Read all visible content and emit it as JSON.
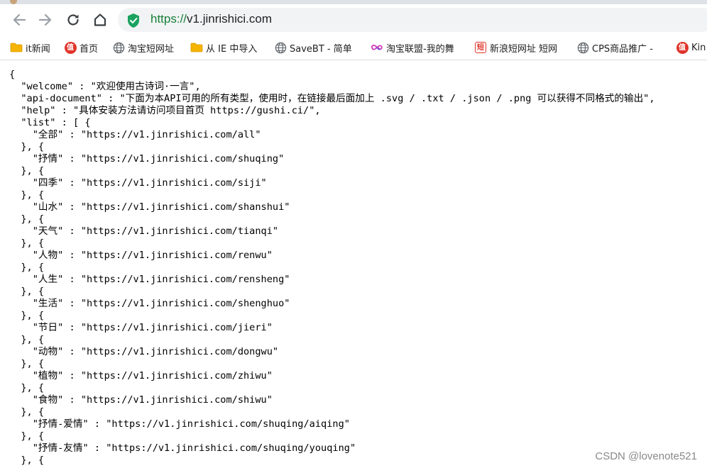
{
  "browser": {
    "url_scheme": "https://",
    "url_host": "v1.jinrishici.com"
  },
  "bookmarks": [
    {
      "label": "it新闻",
      "icon": "folder-icon"
    },
    {
      "label": "首页",
      "icon": "red-badge-icon",
      "glyph": "值"
    },
    {
      "label": "淘宝短网址",
      "icon": "globe-icon"
    },
    {
      "label": "从 IE 中导入",
      "icon": "folder-icon"
    },
    {
      "label": "SaveBT - 简单",
      "icon": "globe-icon"
    },
    {
      "label": "淘宝联盟-我的舞",
      "icon": "infinity-icon"
    },
    {
      "label": "新浪短网址 短网",
      "icon": "square-badge-icon",
      "glyph": "短"
    },
    {
      "label": "CPS商品推广 -",
      "icon": "globe-icon"
    },
    {
      "label": "Kin",
      "icon": "red-badge-icon",
      "glyph": "值"
    }
  ],
  "json_text": "{\n  \"welcome\" : \"欢迎使用古诗词·一言\",\n  \"api-document\" : \"下面为本API可用的所有类型，使用时，在链接最后面加上 .svg / .txt / .json / .png 可以获得不同格式的输出\",\n  \"help\" : \"具体安装方法请访问项目首页 https://gushi.ci/\",\n  \"list\" : [ {\n    \"全部\" : \"https://v1.jinrishici.com/all\"\n  }, {\n    \"抒情\" : \"https://v1.jinrishici.com/shuqing\"\n  }, {\n    \"四季\" : \"https://v1.jinrishici.com/siji\"\n  }, {\n    \"山水\" : \"https://v1.jinrishici.com/shanshui\"\n  }, {\n    \"天气\" : \"https://v1.jinrishici.com/tianqi\"\n  }, {\n    \"人物\" : \"https://v1.jinrishici.com/renwu\"\n  }, {\n    \"人生\" : \"https://v1.jinrishici.com/rensheng\"\n  }, {\n    \"生活\" : \"https://v1.jinrishici.com/shenghuo\"\n  }, {\n    \"节日\" : \"https://v1.jinrishici.com/jieri\"\n  }, {\n    \"动物\" : \"https://v1.jinrishici.com/dongwu\"\n  }, {\n    \"植物\" : \"https://v1.jinrishici.com/zhiwu\"\n  }, {\n    \"食物\" : \"https://v1.jinrishici.com/shiwu\"\n  }, {\n    \"抒情-爱情\" : \"https://v1.jinrishici.com/shuqing/aiqing\"\n  }, {\n    \"抒情-友情\" : \"https://v1.jinrishici.com/shuqing/youqing\"\n  }, {",
  "watermark": "CSDN @lovenote521",
  "colors": {
    "secure_green": "#188038",
    "bookmark_red": "#e0352b",
    "folder_yellow": "#f5b400"
  }
}
